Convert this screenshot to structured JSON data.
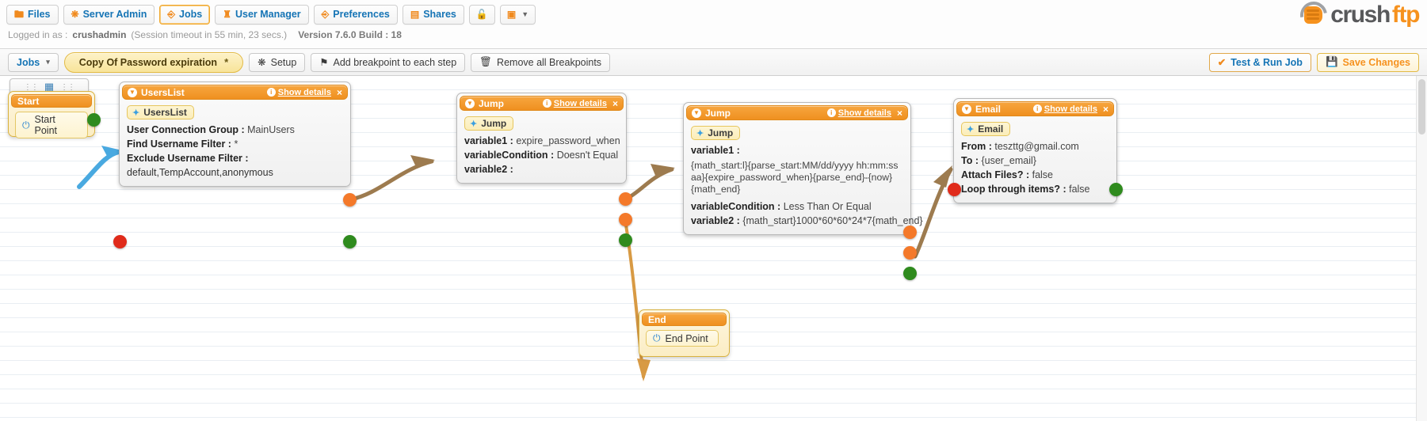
{
  "nav": {
    "items": [
      {
        "label": "Files",
        "icon": "folder-icon",
        "active": false
      },
      {
        "label": "Server Admin",
        "icon": "gear-icon",
        "active": false
      },
      {
        "label": "Jobs",
        "icon": "clipboard-icon",
        "active": true
      },
      {
        "label": "User Manager",
        "icon": "user-icon",
        "active": false
      },
      {
        "label": "Preferences",
        "icon": "clipboard-icon",
        "active": false
      },
      {
        "label": "Shares",
        "icon": "book-icon",
        "active": false
      }
    ],
    "lock_icon": "lock-icon",
    "image_icon": "image-icon"
  },
  "status": {
    "logged_in_label": "Logged in as :",
    "username": "crushadmin",
    "session": "(Session timeout in 55 min, 23 secs.)",
    "version": "Version 7.6.0 Build : 18"
  },
  "logo": {
    "part1": "crush",
    "part2": "ftp"
  },
  "toolbar": {
    "jobs_label": "Jobs",
    "job_name": "Copy Of Password expiration",
    "job_modified_marker": "*",
    "setup_label": "Setup",
    "add_breakpoint_label": "Add breakpoint to each step",
    "remove_breakpoints_label": "Remove all Breakpoints",
    "test_run_label": "Test & Run Job",
    "save_label": "Save Changes"
  },
  "canvas": {
    "start": {
      "title": "Start",
      "point_label": "Start Point"
    },
    "end": {
      "title": "End",
      "point_label": "End Point"
    },
    "nodes": [
      {
        "title": "UsersList",
        "chip": "UsersList",
        "details_label": "Show details",
        "close_label": "×",
        "props": [
          {
            "key": "User Connection Group :",
            "value": "MainUsers"
          },
          {
            "key": "Find Username Filter :",
            "value": "*"
          },
          {
            "key": "Exclude Username Filter :",
            "value": ""
          }
        ],
        "extra": "default,TempAccount,anonymous"
      },
      {
        "title": "Jump",
        "chip": "Jump",
        "details_label": "Show details",
        "close_label": "×",
        "props": [
          {
            "key": "variable1 :",
            "value": "expire_password_when"
          },
          {
            "key": "variableCondition :",
            "value": "Doesn't Equal"
          },
          {
            "key": "variable2 :",
            "value": ""
          }
        ]
      },
      {
        "title": "Jump",
        "chip": "Jump",
        "details_label": "Show details",
        "close_label": "×",
        "props": [
          {
            "key": "variable1 :",
            "value": ""
          }
        ],
        "expression": "{math_start:l}{parse_start:MM/dd/yyyy hh:mm:ss aa}{expire_password_when}{parse_end}-{now}{math_end}",
        "props2": [
          {
            "key": "variableCondition :",
            "value": "Less Than Or Equal"
          },
          {
            "key": "variable2 :",
            "value": "{math_start}1000*60*60*24*7{math_end}"
          }
        ]
      },
      {
        "title": "Email",
        "chip": "Email",
        "details_label": "Show details",
        "close_label": "×",
        "props": [
          {
            "key": "From :",
            "value": "teszttg@gmail.com"
          },
          {
            "key": "To :",
            "value": "{user_email}"
          },
          {
            "key": "Attach Files? :",
            "value": "false"
          },
          {
            "key": "Loop through items? :",
            "value": "false"
          }
        ]
      }
    ]
  },
  "colors": {
    "accent_orange": "#f08a1e",
    "link_blue": "#1574b5",
    "port_orange": "#f4792a",
    "port_green": "#2f8b1e",
    "port_red": "#e02b1b",
    "edge_brown": "#9d7b4f",
    "edge_blue": "#49a9e0"
  }
}
